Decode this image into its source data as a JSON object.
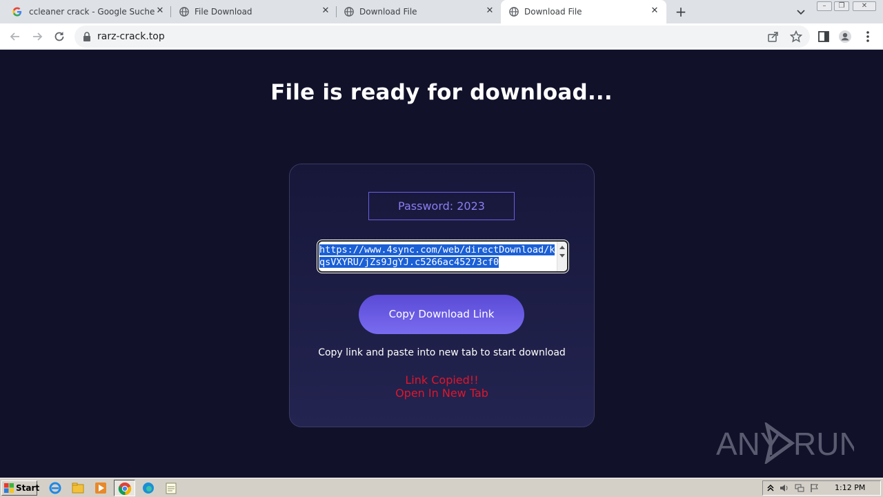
{
  "tabs": [
    {
      "title": "ccleaner crack - Google Suche",
      "favicon": "google-icon",
      "active": false
    },
    {
      "title": "File Download",
      "favicon": "globe-icon",
      "active": false
    },
    {
      "title": "Download File",
      "favicon": "globe-icon",
      "active": false
    },
    {
      "title": "Download File",
      "favicon": "globe-icon",
      "active": true
    }
  ],
  "toolbar": {
    "url": "rarz-crack.top"
  },
  "page": {
    "headline": "File is ready for download...",
    "password": "Password: 2023",
    "link": "https://www.4sync.com/web/directDownload/kqsVXYRU/jZs9JgYJ.c5266ac45273cf0",
    "copy_button": "Copy Download Link",
    "instruction": "Copy link and paste into new tab to start download",
    "status_line1": "Link Copied!!",
    "status_line2": "Open In New Tab"
  },
  "watermark": {
    "left": "ANY",
    "right": "RUN"
  },
  "taskbar": {
    "start_label": "Start",
    "clock": "1:12 PM"
  },
  "colors": {
    "page_bg": "#11112a",
    "accent": "#6a5ee0",
    "status_red": "#e0162b"
  }
}
